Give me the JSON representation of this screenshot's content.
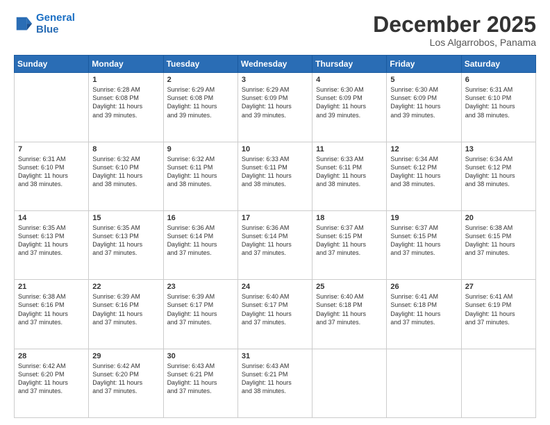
{
  "header": {
    "logo_line1": "General",
    "logo_line2": "Blue",
    "month": "December 2025",
    "location": "Los Algarrobos, Panama"
  },
  "days_of_week": [
    "Sunday",
    "Monday",
    "Tuesday",
    "Wednesday",
    "Thursday",
    "Friday",
    "Saturday"
  ],
  "weeks": [
    [
      {
        "day": "",
        "info": ""
      },
      {
        "day": "1",
        "info": "Sunrise: 6:28 AM\nSunset: 6:08 PM\nDaylight: 11 hours\nand 39 minutes."
      },
      {
        "day": "2",
        "info": "Sunrise: 6:29 AM\nSunset: 6:08 PM\nDaylight: 11 hours\nand 39 minutes."
      },
      {
        "day": "3",
        "info": "Sunrise: 6:29 AM\nSunset: 6:09 PM\nDaylight: 11 hours\nand 39 minutes."
      },
      {
        "day": "4",
        "info": "Sunrise: 6:30 AM\nSunset: 6:09 PM\nDaylight: 11 hours\nand 39 minutes."
      },
      {
        "day": "5",
        "info": "Sunrise: 6:30 AM\nSunset: 6:09 PM\nDaylight: 11 hours\nand 39 minutes."
      },
      {
        "day": "6",
        "info": "Sunrise: 6:31 AM\nSunset: 6:10 PM\nDaylight: 11 hours\nand 38 minutes."
      }
    ],
    [
      {
        "day": "7",
        "info": "Sunrise: 6:31 AM\nSunset: 6:10 PM\nDaylight: 11 hours\nand 38 minutes."
      },
      {
        "day": "8",
        "info": "Sunrise: 6:32 AM\nSunset: 6:10 PM\nDaylight: 11 hours\nand 38 minutes."
      },
      {
        "day": "9",
        "info": "Sunrise: 6:32 AM\nSunset: 6:11 PM\nDaylight: 11 hours\nand 38 minutes."
      },
      {
        "day": "10",
        "info": "Sunrise: 6:33 AM\nSunset: 6:11 PM\nDaylight: 11 hours\nand 38 minutes."
      },
      {
        "day": "11",
        "info": "Sunrise: 6:33 AM\nSunset: 6:11 PM\nDaylight: 11 hours\nand 38 minutes."
      },
      {
        "day": "12",
        "info": "Sunrise: 6:34 AM\nSunset: 6:12 PM\nDaylight: 11 hours\nand 38 minutes."
      },
      {
        "day": "13",
        "info": "Sunrise: 6:34 AM\nSunset: 6:12 PM\nDaylight: 11 hours\nand 38 minutes."
      }
    ],
    [
      {
        "day": "14",
        "info": "Sunrise: 6:35 AM\nSunset: 6:13 PM\nDaylight: 11 hours\nand 37 minutes."
      },
      {
        "day": "15",
        "info": "Sunrise: 6:35 AM\nSunset: 6:13 PM\nDaylight: 11 hours\nand 37 minutes."
      },
      {
        "day": "16",
        "info": "Sunrise: 6:36 AM\nSunset: 6:14 PM\nDaylight: 11 hours\nand 37 minutes."
      },
      {
        "day": "17",
        "info": "Sunrise: 6:36 AM\nSunset: 6:14 PM\nDaylight: 11 hours\nand 37 minutes."
      },
      {
        "day": "18",
        "info": "Sunrise: 6:37 AM\nSunset: 6:15 PM\nDaylight: 11 hours\nand 37 minutes."
      },
      {
        "day": "19",
        "info": "Sunrise: 6:37 AM\nSunset: 6:15 PM\nDaylight: 11 hours\nand 37 minutes."
      },
      {
        "day": "20",
        "info": "Sunrise: 6:38 AM\nSunset: 6:15 PM\nDaylight: 11 hours\nand 37 minutes."
      }
    ],
    [
      {
        "day": "21",
        "info": "Sunrise: 6:38 AM\nSunset: 6:16 PM\nDaylight: 11 hours\nand 37 minutes."
      },
      {
        "day": "22",
        "info": "Sunrise: 6:39 AM\nSunset: 6:16 PM\nDaylight: 11 hours\nand 37 minutes."
      },
      {
        "day": "23",
        "info": "Sunrise: 6:39 AM\nSunset: 6:17 PM\nDaylight: 11 hours\nand 37 minutes."
      },
      {
        "day": "24",
        "info": "Sunrise: 6:40 AM\nSunset: 6:17 PM\nDaylight: 11 hours\nand 37 minutes."
      },
      {
        "day": "25",
        "info": "Sunrise: 6:40 AM\nSunset: 6:18 PM\nDaylight: 11 hours\nand 37 minutes."
      },
      {
        "day": "26",
        "info": "Sunrise: 6:41 AM\nSunset: 6:18 PM\nDaylight: 11 hours\nand 37 minutes."
      },
      {
        "day": "27",
        "info": "Sunrise: 6:41 AM\nSunset: 6:19 PM\nDaylight: 11 hours\nand 37 minutes."
      }
    ],
    [
      {
        "day": "28",
        "info": "Sunrise: 6:42 AM\nSunset: 6:20 PM\nDaylight: 11 hours\nand 37 minutes."
      },
      {
        "day": "29",
        "info": "Sunrise: 6:42 AM\nSunset: 6:20 PM\nDaylight: 11 hours\nand 37 minutes."
      },
      {
        "day": "30",
        "info": "Sunrise: 6:43 AM\nSunset: 6:21 PM\nDaylight: 11 hours\nand 37 minutes."
      },
      {
        "day": "31",
        "info": "Sunrise: 6:43 AM\nSunset: 6:21 PM\nDaylight: 11 hours\nand 38 minutes."
      },
      {
        "day": "",
        "info": ""
      },
      {
        "day": "",
        "info": ""
      },
      {
        "day": "",
        "info": ""
      }
    ]
  ]
}
